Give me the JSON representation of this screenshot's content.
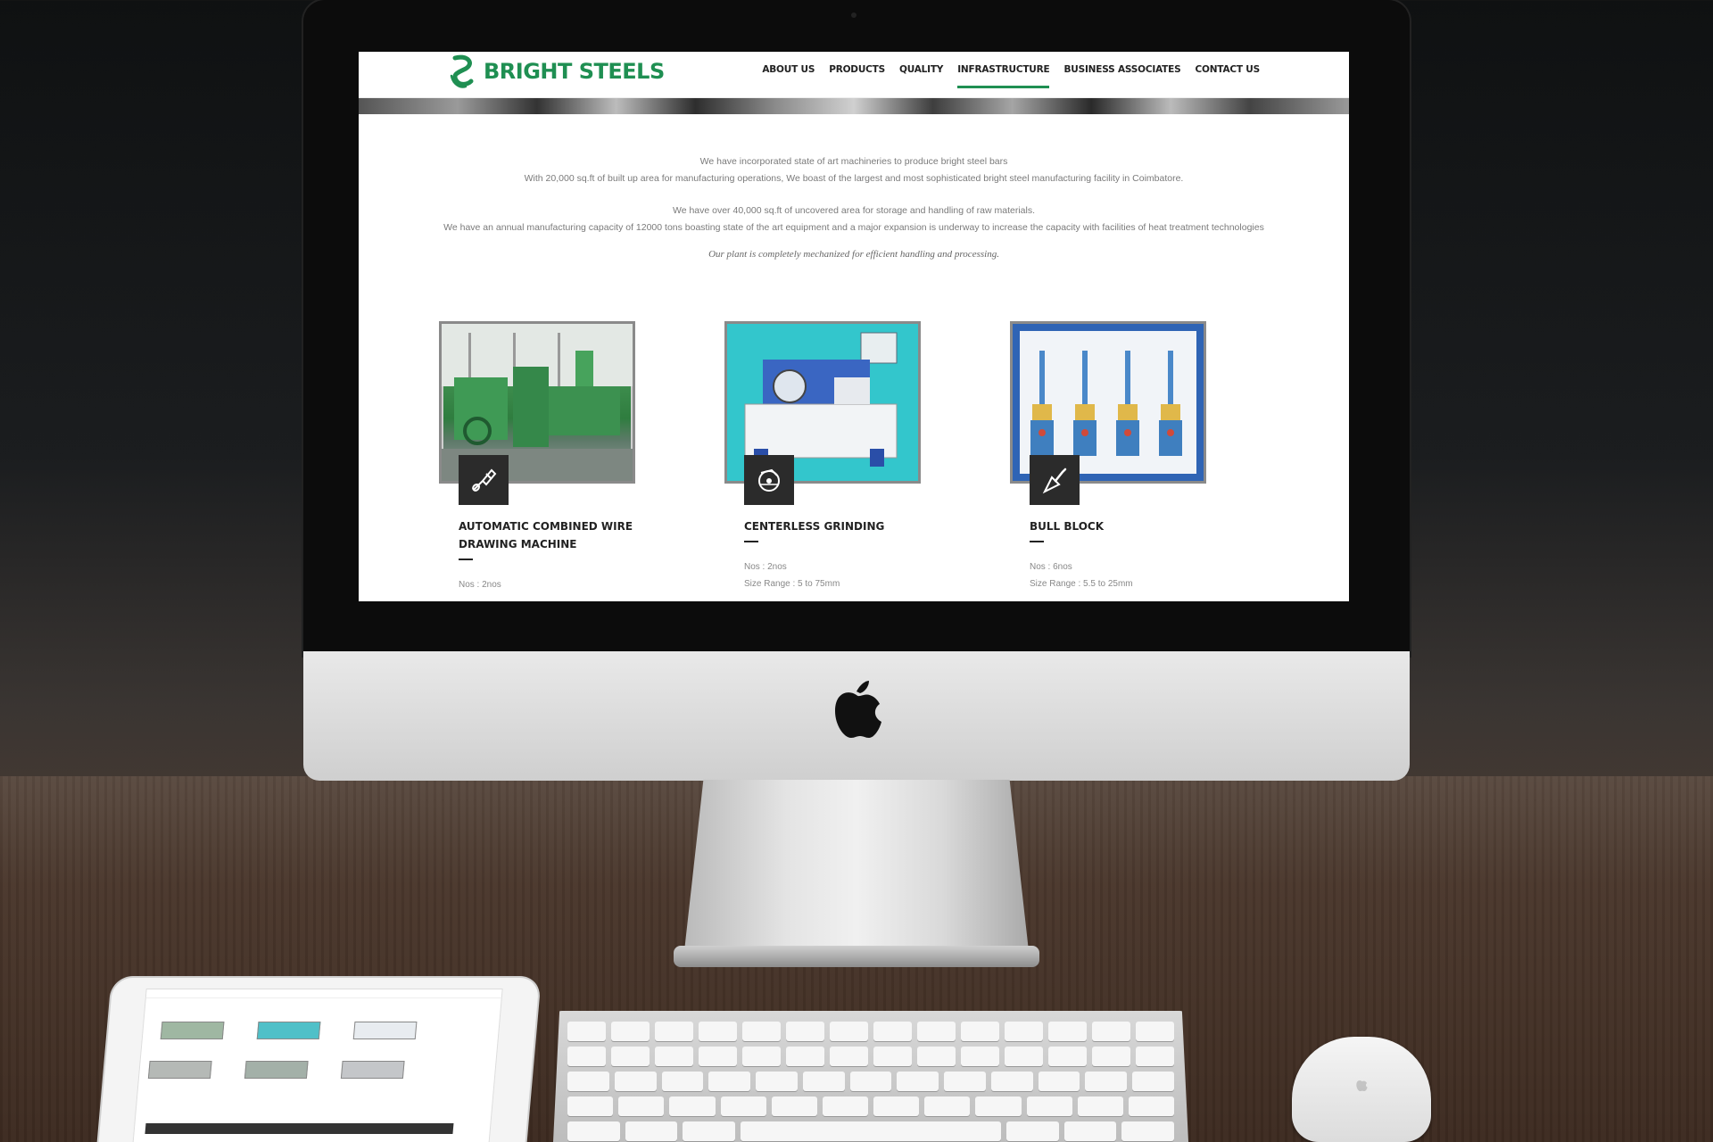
{
  "site": {
    "logo_text": "BRIGHT STEELS",
    "brand_color": "#1f8f52",
    "nav": [
      {
        "label": "ABOUT US",
        "active": false
      },
      {
        "label": "PRODUCTS",
        "active": false
      },
      {
        "label": "QUALITY",
        "active": false
      },
      {
        "label": "INFRASTRUCTURE",
        "active": true
      },
      {
        "label": "BUSINESS ASSOCIATES",
        "active": false
      },
      {
        "label": "CONTACT US",
        "active": false
      }
    ]
  },
  "intro": {
    "line1": "We have incorporated state of art machineries to produce bright steel bars",
    "line2": "With 20,000 sq.ft of built up area for manufacturing operations, We boast of the largest and most sophisticated bright steel manufacturing facility in Coimbatore.",
    "line3": "We have over 40,000 sq.ft of uncovered area for storage and handling of raw materials.",
    "line4": "We have an annual manufacturing capacity of 12000 tons boasting state of the art equipment and a major expansion is underway to increase the capacity with facilities of heat treatment technologies",
    "tagline": "Our plant is completely mechanized for efficient handling and processing."
  },
  "cards": [
    {
      "title": "AUTOMATIC COMBINED WIRE DRAWING MACHINE",
      "icon": "paintbrush-icon",
      "specs": [
        "Nos : 2nos"
      ]
    },
    {
      "title": "CENTERLESS GRINDING",
      "icon": "circular-saw-icon",
      "specs": [
        "Nos : 2nos",
        "Size Range : 5 to 75mm"
      ]
    },
    {
      "title": "BULL BLOCK",
      "icon": "trowel-icon",
      "specs": [
        "Nos : 6nos",
        "Size Range : 5.5 to 25mm"
      ]
    }
  ]
}
